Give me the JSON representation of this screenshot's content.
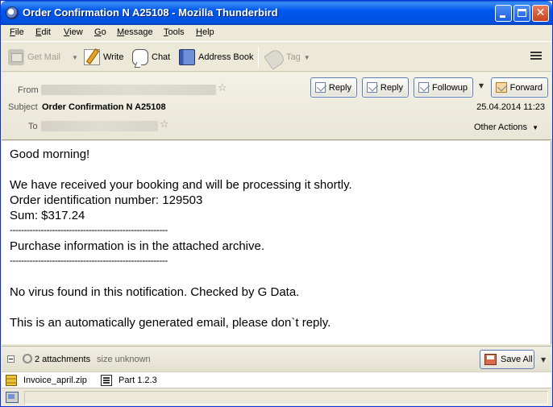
{
  "window": {
    "title": "Order Confirmation N A25108 - Mozilla Thunderbird",
    "buttons": [
      "minimize",
      "maximize",
      "close"
    ]
  },
  "menubar": {
    "items": [
      {
        "label": "File",
        "accel": "F",
        "rest": "ile"
      },
      {
        "label": "Edit",
        "accel": "E",
        "rest": "dit"
      },
      {
        "label": "View",
        "accel": "V",
        "rest": "iew"
      },
      {
        "label": "Go",
        "accel": "G",
        "rest": "o"
      },
      {
        "label": "Message",
        "accel": "M",
        "rest": "essage"
      },
      {
        "label": "Tools",
        "accel": "T",
        "rest": "ools"
      },
      {
        "label": "Help",
        "accel": "H",
        "rest": "elp"
      }
    ]
  },
  "toolbar": {
    "get_mail": {
      "label": "Get Mail",
      "icon": "get-mail-icon",
      "enabled": false
    },
    "write": {
      "label": "Write",
      "icon": "pencil-icon"
    },
    "chat": {
      "label": "Chat",
      "icon": "chat-bubble-icon"
    },
    "address_book": {
      "label": "Address Book",
      "icon": "address-book-icon"
    },
    "tag": {
      "label": "Tag",
      "icon": "tag-icon",
      "enabled": false
    },
    "menu_icon": "hamburger-menu-icon"
  },
  "header": {
    "from_label": "From",
    "subject_label": "Subject",
    "to_label": "To",
    "subject": "Order Confirmation N A25108",
    "date": "25.04.2014 11:23",
    "buttons": {
      "reply": "Reply",
      "reply_all": "Reply",
      "followup": "Followup",
      "forward": "Forward"
    },
    "other_actions": "Other Actions"
  },
  "body": {
    "lines": [
      "Good morning!",
      "We have received your booking and will be processing it shortly.",
      "Order identification number: 129503",
      "Sum: $317.24",
      "--------------------------------------------------------",
      "Purchase information is in the attached archive.",
      "--------------------------------------------------------",
      "No virus found in this notification. Checked by G Data.",
      "This is an automatically generated email, please don`t reply."
    ]
  },
  "attachments": {
    "count_label": "2 attachments",
    "size_label": "size unknown",
    "save_all": "Save All",
    "items": [
      {
        "name": "Invoice_april.zip",
        "icon": "zip-archive-icon"
      },
      {
        "name": "Part 1.2.3",
        "icon": "document-part-icon"
      }
    ]
  },
  "colors": {
    "titlebar": "#0058ee",
    "window_bg": "#ece9d8",
    "header_bg": "#f3f1e6",
    "button_border": "#5b7bb6"
  }
}
